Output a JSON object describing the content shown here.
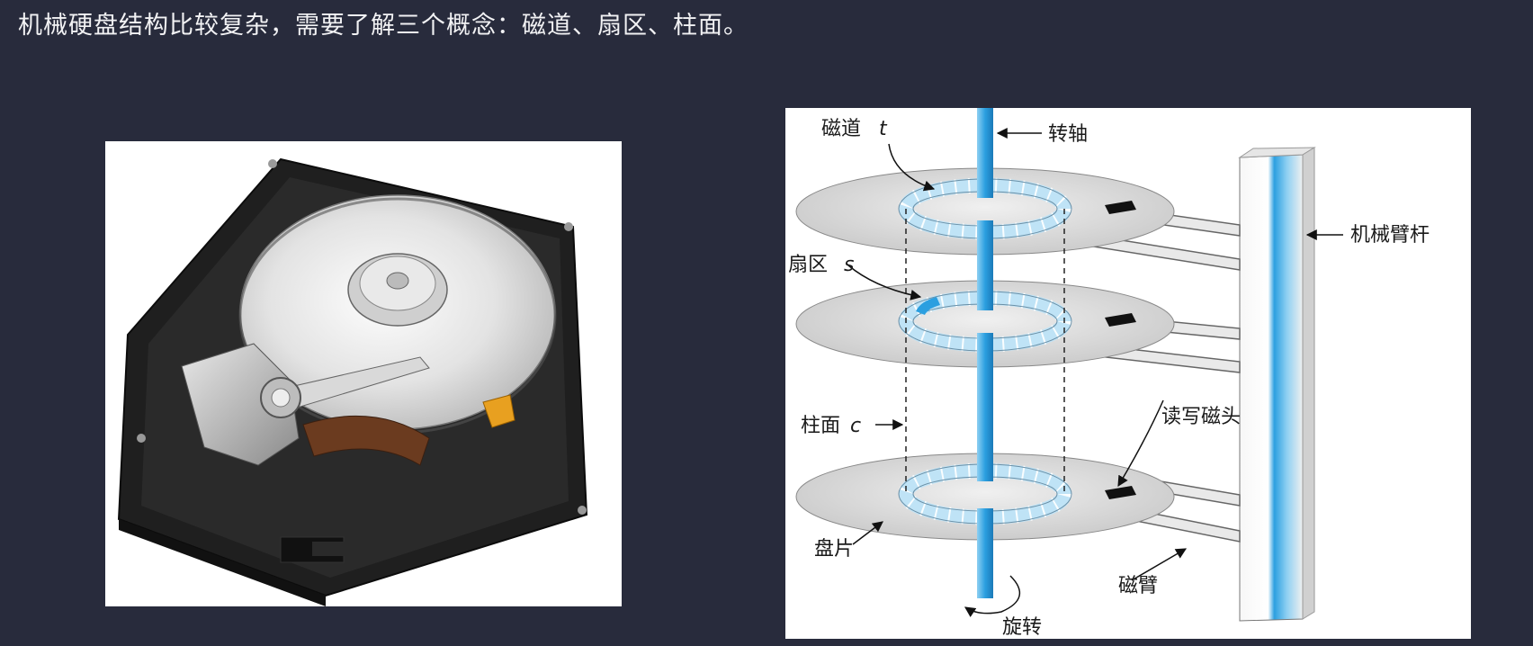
{
  "slide": {
    "heading": "机械硬盘结构比较复杂，需要了解三个概念：磁道、扇区、柱面。"
  },
  "diagram": {
    "labels": {
      "track": "磁道",
      "track_var": "t",
      "spindle": "转轴",
      "sector": "扇区",
      "sector_var": "s",
      "actuator_arm": "机械臂杆",
      "cylinder": "柱面",
      "cylinder_var": "c",
      "read_write_head": "读写磁头",
      "platter": "盘片",
      "head_arm": "磁臂",
      "rotation": "旋转"
    }
  },
  "colors": {
    "background": "#282b3c",
    "spindle_blue": "#2b9fe0",
    "track_blue": "#bfe3f6"
  }
}
